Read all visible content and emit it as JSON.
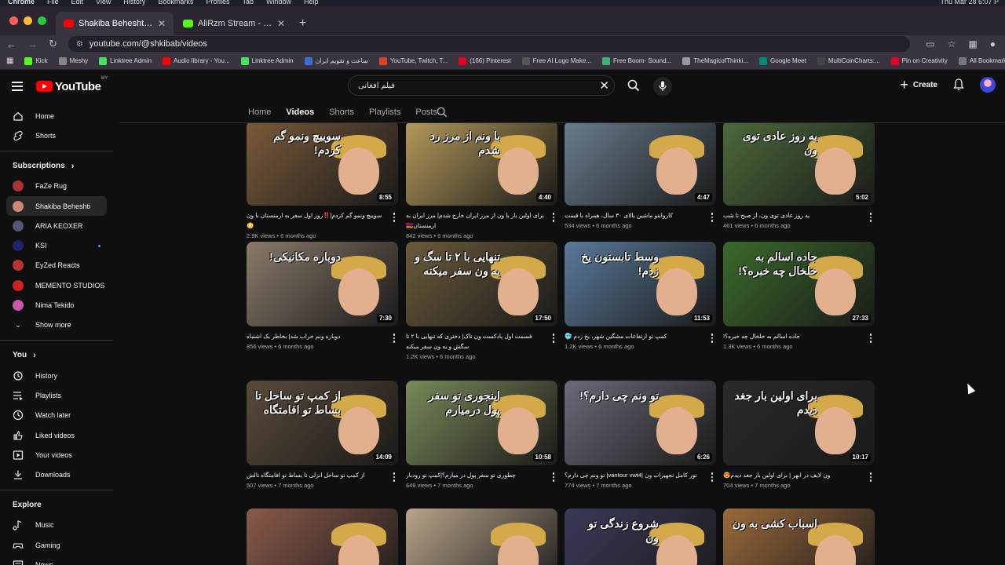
{
  "mac_menu": {
    "items": [
      "Chrome",
      "File",
      "Edit",
      "View",
      "History",
      "Bookmarks",
      "Profiles",
      "Tab",
      "Window",
      "Help"
    ],
    "clock": "Thu Mar 28 6:07 P"
  },
  "tabs": [
    {
      "title": "Shakiba Beheshti - YouTube",
      "color": "#ff0000"
    },
    {
      "title": "AliRzm Stream - Watch Live o",
      "color": "#53fc18"
    }
  ],
  "address": {
    "url": "youtube.com/@shkibab/videos"
  },
  "bookmarks": [
    {
      "label": "Kick",
      "color": "#53fc18"
    },
    {
      "label": "Meshy",
      "color": "#888888"
    },
    {
      "label": "Linktree Admin",
      "color": "#43e55e"
    },
    {
      "label": "Audio library - You...",
      "color": "#ff0000"
    },
    {
      "label": "Linktree Admin",
      "color": "#43e55e"
    },
    {
      "label": "ساعت و تقویم ایران",
      "color": "#3a6fd8"
    },
    {
      "label": "YouTube, Twitch, T...",
      "color": "#e0402a"
    },
    {
      "label": "(166) Pinterest",
      "color": "#e60023"
    },
    {
      "label": "Free AI Logo Make...",
      "color": "#555555"
    },
    {
      "label": "Free Boom- Sound...",
      "color": "#3cb371"
    },
    {
      "label": "TheMagicofThinki...",
      "color": "#999999"
    },
    {
      "label": "Google Meet",
      "color": "#00897b"
    },
    {
      "label": "MultiCoinCharts:...",
      "color": "#444444"
    },
    {
      "label": "Pin on Creativity",
      "color": "#e60023"
    },
    {
      "label": "All Bookmarks",
      "color": "#777777"
    }
  ],
  "header": {
    "brand": "YouTube",
    "country": "MY",
    "search_value": "فیلم افغانی",
    "create_label": "Create"
  },
  "sidebar": {
    "main": [
      {
        "label": "Home",
        "icon": "home-icon"
      },
      {
        "label": "Shorts",
        "icon": "shorts-icon"
      }
    ],
    "subs_title": "Subscriptions",
    "subs": [
      {
        "label": "FaZe Rug",
        "color": "#a33"
      },
      {
        "label": "Shakiba Beheshti",
        "color": "#c87"
      },
      {
        "label": "ARIA KEOXER",
        "color": "#557"
      },
      {
        "label": "KSI",
        "color": "#226"
      },
      {
        "label": "EyZed Reacts",
        "color": "#b33"
      },
      {
        "label": "MEMENTO STUDIOS",
        "color": "#c22"
      },
      {
        "label": "Nima Tekido",
        "color": "#c5a"
      }
    ],
    "show_more": "Show more",
    "you_title": "You",
    "you": [
      {
        "label": "History",
        "icon": "history-icon"
      },
      {
        "label": "Playlists",
        "icon": "playlists-icon"
      },
      {
        "label": "Watch later",
        "icon": "watch-later-icon"
      },
      {
        "label": "Liked videos",
        "icon": "liked-icon"
      },
      {
        "label": "Your videos",
        "icon": "your-videos-icon"
      },
      {
        "label": "Downloads",
        "icon": "downloads-icon"
      }
    ],
    "explore_title": "Explore",
    "explore": [
      {
        "label": "Music",
        "icon": "music-icon"
      },
      {
        "label": "Gaming",
        "icon": "gaming-icon"
      },
      {
        "label": "News",
        "icon": "news-icon"
      }
    ]
  },
  "channel_tabs": [
    "Home",
    "Videos",
    "Shorts",
    "Playlists",
    "Posts"
  ],
  "videos": [
    {
      "title": "سوییچ ونمو گم کردم|‼️روز اول سفر به ارمنستان با ون😳",
      "overlay": "سوییچ ونمو گم کردم!",
      "duration": "8:55",
      "views": "2.9K views",
      "age": "6 months ago",
      "bg": "#7a5a3a"
    },
    {
      "title": "برای اولین بار با ون از مرز ایران خارج شدم| مرز ایران به ارمنستان🇦🇲",
      "overlay": "با ونم از مرز رد شدم",
      "duration": "4:40",
      "views": "842 views",
      "age": "6 months ago",
      "bg": "#b59a5a"
    },
    {
      "title": "کاروانتو ماشین بالای ۳۰ سال، همراه با قیمت",
      "overlay": "",
      "duration": "4:47",
      "views": "534 views",
      "age": "6 months ago",
      "bg": "#6a7d8f"
    },
    {
      "title": "یه روز عادی توی ون، از صبح تا شب",
      "overlay": "یه روز عادی توی ون",
      "duration": "5:02",
      "views": "461 views",
      "age": "6 months ago",
      "bg": "#4d6a3a"
    },
    {
      "title": "دوباره ونم خراب شد| بخاطر یک اشتباه",
      "overlay": "دوباره مکانیکی!",
      "duration": "7:30",
      "views": "856 views",
      "age": "6 months ago",
      "bg": "#8a7a6a"
    },
    {
      "title": "قسمت اول پادکست ون تاک| دختری که تنهایی با ۲ تا سگش و یه ون سفر میکنه",
      "overlay": "تنهایی با ۲ تا سگ و یه ون سفر میکنه",
      "duration": "17:50",
      "views": "1.2K views",
      "age": "6 months ago",
      "bg": "#6a5a3a"
    },
    {
      "title": "کمپ تو ارتفاعات مشگین شهر، یخ زدم 🥶",
      "overlay": "وسط تابستون یخ زدم!",
      "duration": "11:53",
      "views": "1.2K views",
      "age": "6 months ago",
      "bg": "#5a7a9a"
    },
    {
      "title": "جاده اسالم به خلخال چه خبره؟!",
      "overlay": "جاده اسالم به خلخال چه خبره؟!",
      "duration": "27:33",
      "views": "1.3K views",
      "age": "6 months ago",
      "bg": "#3a6a2a"
    },
    {
      "title": "از کمپ تو ساحل انزلی تا بساط تو افامتگاه تالش",
      "overlay": "از کمپ تو ساحل تا بساط تو اقامتگاه",
      "duration": "14:09",
      "views": "507 views",
      "age": "7 months ago",
      "bg": "#5a4a3a"
    },
    {
      "title": "چطوری تو سفر پول در میارم؟|کمپ تو رودبار",
      "overlay": "اینجوری تو سفر پول درمیارم",
      "duration": "10:58",
      "views": "649 views",
      "age": "7 months ago",
      "bg": "#7a8a5a"
    },
    {
      "title": "تور کامل تجهیزات ون |vantour vwt4| تو ونم چی دارم؟",
      "overlay": "تو ونم چی دارم؟!",
      "duration": "6:26",
      "views": "774 views",
      "age": "7 months ago",
      "bg": "#6a6a7a"
    },
    {
      "title": "ون لایف در ابهر | برای اولین بار جغد دیدم😍",
      "overlay": "برای اولین بار جغد دیدم",
      "duration": "10:17",
      "views": "704 views",
      "age": "7 months ago",
      "bg": "#2a2a2a"
    },
    {
      "title": "",
      "overlay": "",
      "duration": "",
      "views": "",
      "age": "",
      "bg": "#8a5a4a"
    },
    {
      "title": "",
      "overlay": "",
      "duration": "",
      "views": "",
      "age": "",
      "bg": "#b9a48a"
    },
    {
      "title": "",
      "overlay": "شروع زندگی تو ون",
      "duration": "",
      "views": "",
      "age": "",
      "bg": "#3a3a5a"
    },
    {
      "title": "",
      "overlay": "اسباب کشی به ون",
      "duration": "",
      "views": "",
      "age": "",
      "bg": "#9a6a3a"
    }
  ]
}
